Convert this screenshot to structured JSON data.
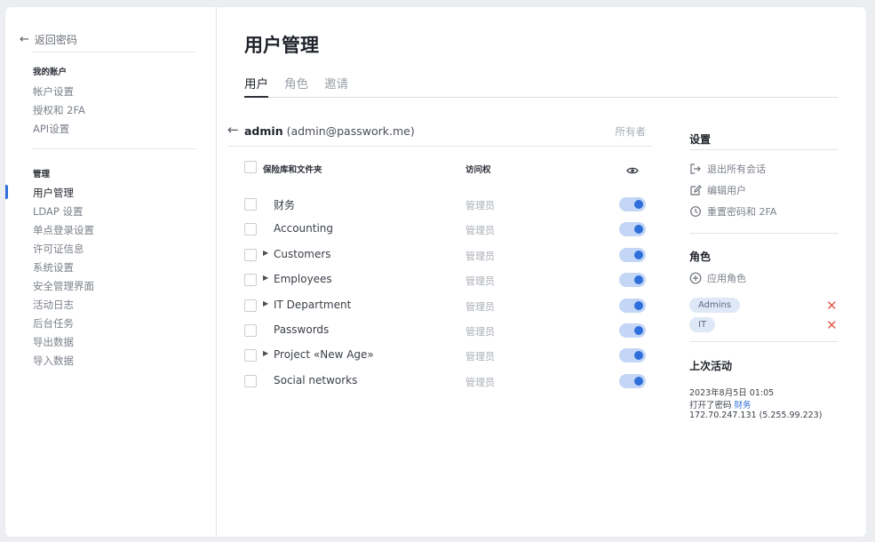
{
  "sidebar": {
    "back_label": "返回密码",
    "sections": [
      {
        "heading": "我的账户",
        "items": [
          "帐户设置",
          "授权和 2FA",
          "API设置"
        ]
      },
      {
        "heading": "管理",
        "items": [
          "用户管理",
          "LDAP 设置",
          "单点登录设置",
          "许可证信息",
          "系统设置",
          "安全管理界面",
          "活动日志",
          "后台任务",
          "导出数据",
          "导入数据"
        ]
      }
    ],
    "active_item": "用户管理"
  },
  "page": {
    "title": "用户管理",
    "tabs": [
      {
        "label": "用户",
        "active": true
      },
      {
        "label": "角色",
        "active": false
      },
      {
        "label": "邀请",
        "active": false
      }
    ]
  },
  "user": {
    "login": "admin",
    "email": "(admin@passwork.me)",
    "role_label": "所有者"
  },
  "table": {
    "columns": [
      "保险库和文件夹",
      "访问权"
    ],
    "visibility_icon": "eye-icon",
    "rows": [
      {
        "name": "财务",
        "expandable": false,
        "access": "管理员",
        "enabled": true
      },
      {
        "name": "Accounting",
        "expandable": false,
        "access": "管理员",
        "enabled": true
      },
      {
        "name": "Customers",
        "expandable": true,
        "access": "管理员",
        "enabled": true
      },
      {
        "name": "Employees",
        "expandable": true,
        "access": "管理员",
        "enabled": true
      },
      {
        "name": "IT Department",
        "expandable": true,
        "access": "管理员",
        "enabled": true
      },
      {
        "name": "Passwords",
        "expandable": false,
        "access": "管理员",
        "enabled": true
      },
      {
        "name": "Project «New Age»",
        "expandable": true,
        "access": "管理员",
        "enabled": true
      },
      {
        "name": "Social networks",
        "expandable": false,
        "access": "管理员",
        "enabled": true
      }
    ]
  },
  "settings": {
    "title": "设置",
    "actions": [
      "退出所有会话",
      "编辑用户",
      "重置密码和 2FA"
    ],
    "roles_title": "角色",
    "apply_role_label": "应用角色",
    "roles": [
      "Admins",
      "IT"
    ],
    "last_activity_title": "上次活动",
    "last_activity": {
      "datetime": "2023年8月5日 01:05",
      "action_prefix": "打开了密码",
      "action_target": "财务",
      "ip": "172.70.247.131 (5.255.99.223)"
    }
  },
  "colors": {
    "accent": "#2f6fdb",
    "toggle_track": "#c3d6f5",
    "remove": "#e0604e",
    "chip": "#dfe8f6"
  }
}
